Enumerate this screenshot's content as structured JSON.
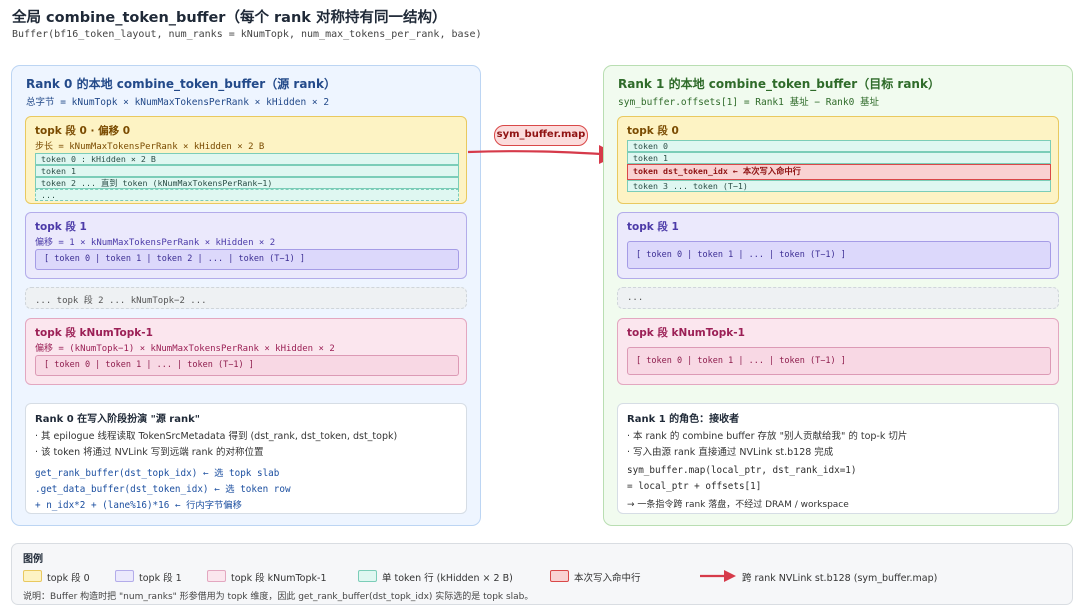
{
  "header": {
    "title": "全局 combine_token_buffer（每个 rank 对称持有同一结构）",
    "subtitle": "Buffer(bf16_token_layout, num_ranks = kNumTopk, num_max_tokens_per_rank, base)"
  },
  "left": {
    "title": "Rank 0 的本地 combine_token_buffer（源 rank）",
    "sub": "总字节 = kNumTopk × kNumMaxTokensPerRank × kHidden × 2",
    "seg0": {
      "title": "topk 段 0 · 偏移 0",
      "sub": "步长 = kNumMaxTokensPerRank × kHidden × 2 B",
      "rows": [
        "token 0 : kHidden × 2 B",
        "token 1",
        "token 2 ... 直到 token (kNumMaxTokensPerRank−1)",
        "..."
      ]
    },
    "seg1": {
      "title": "topk 段 1",
      "sub": "偏移 = 1 × kNumMaxTokensPerRank × kHidden × 2",
      "box": "[ token 0 | token 1 | token 2 | ... | token (T−1) ]"
    },
    "dots": "... topk 段 2 ... kNumTopk−2 ...",
    "segLast": {
      "title": "topk 段 kNumTopk-1",
      "sub": "偏移 = (kNumTopk−1) × kNumMaxTokensPerRank × kHidden × 2",
      "box": "[ token 0 | token 1 | ... | token (T−1) ]"
    },
    "info": {
      "title": "Rank 0 在写入阶段扮演 \"源 rank\"",
      "lines": [
        "· 其 epilogue 线程读取 TokenSrcMetadata 得到 (dst_rank, dst_token, dst_topk)",
        "· 该 token 将通过 NVLink 写到远端 rank 的对称位置"
      ],
      "code": [
        "get_rank_buffer(dst_topk_idx) ← 选 topk slab",
        ".get_data_buffer(dst_token_idx) ← 选 token row",
        "+ n_idx*2 + (lane%16)*16 ← 行内字节偏移"
      ]
    }
  },
  "right": {
    "title": "Rank 1 的本地 combine_token_buffer（目标 rank）",
    "sub": "sym_buffer.offsets[1] = Rank1 基址 − Rank0 基址",
    "seg0": {
      "title": "topk 段 0",
      "rows": [
        "token 0",
        "token 1",
        "token dst_token_idx ← 本次写入命中行",
        "token 3 ... token (T−1)"
      ]
    },
    "seg1": {
      "title": "topk 段 1",
      "box": "[ token 0 | token 1 | ... | token (T−1) ]"
    },
    "dots": "...",
    "segLast": {
      "title": "topk 段 kNumTopk-1",
      "box": "[ token 0 | token 1 | ... | token (T−1) ]"
    },
    "info": {
      "title": "Rank 1 的角色：接收者",
      "lines": [
        "· 本 rank 的 combine buffer 存放 \"别人贡献给我\" 的 top-k 切片",
        "· 写入由源 rank 直接通过 NVLink st.b128 完成"
      ],
      "code": [
        "sym_buffer.map(local_ptr, dst_rank_idx=1)",
        "= local_ptr + offsets[1]",
        "→ 一条指令跨 rank 落盘，不经过 DRAM / workspace"
      ]
    }
  },
  "arrow": {
    "label": "sym_buffer.map"
  },
  "legend": {
    "title": "图例",
    "items": [
      "topk 段 0",
      "topk 段 1",
      "topk 段 kNumTopk-1",
      "单 token 行 (kHidden × 2 B)",
      "本次写入命中行",
      "跨 rank NVLink st.b128 (sym_buffer.map)"
    ],
    "note": "说明：Buffer 构造时把 \"num_ranks\" 形参借用为 topk 维度，因此 get_rank_buffer(dst_topk_idx) 实际选的是 topk slab。"
  },
  "colors": {
    "arrow": "#d63a4a",
    "yellow": "#fdf3c4",
    "purple": "#ebe9fc",
    "pink": "#fbe6ee",
    "teal": "#dff7f1",
    "hit": "#f9d2d2"
  }
}
